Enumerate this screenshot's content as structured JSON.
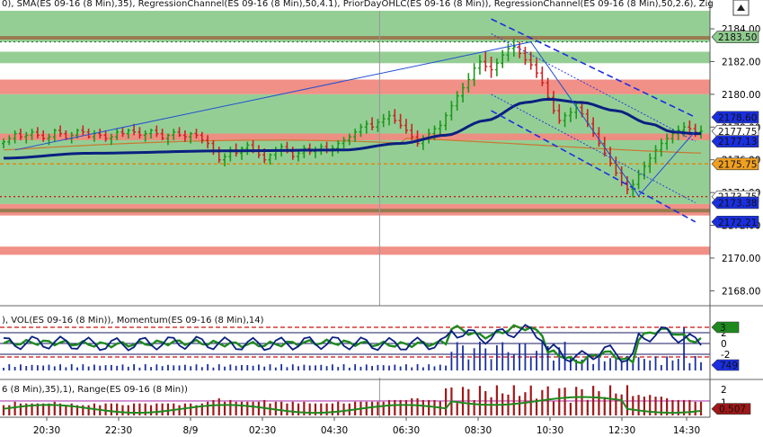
{
  "header": {
    "price_title": "0), SMA(ES 09-16 (8 Min),35), RegressionChannel(ES 09-16 (8 Min),50,4.1), PriorDayOHLC(ES 09-16 (8 Min)), RegressionChannel(ES 09-16 (8 Min),50,2.6), Zig",
    "indicator_title": "), VOL(ES 09-16 (8 Min)), Momentum(ES 09-16 (8 Min),14)",
    "range_title": "6 (8 Min),35),1), Range(ES 09-16 (8 Min))"
  },
  "colors": {
    "green_zone": "#8fcb8f",
    "red_zone": "#f08a80",
    "up_bar": "#1a9a1a",
    "down_bar": "#cc2222",
    "sma": "#0a2080",
    "channel": "#1a2fe0",
    "volume": "#1a2fa0",
    "momentum": "#1e8a1e",
    "range_bar": "#a01818"
  },
  "chart_data": [
    {
      "type": "candlestick",
      "title": "",
      "ylim": [
        2167.2,
        2185.1
      ],
      "y_ticks": [
        "2184.00",
        "2182.00",
        "2180.00",
        "2178.00",
        "2176.00",
        "2174.00",
        "2172.00",
        "2170.00",
        "2168.00"
      ],
      "price_labels": [
        {
          "text": "2183.50",
          "value": 2183.5,
          "bg": "#8fcb8f",
          "fg": "#000000"
        },
        {
          "text": "2178.60",
          "value": 2178.6,
          "bg": "#1a2fe0",
          "fg": "#ffffff"
        },
        {
          "text": "2177.75",
          "value": 2177.75,
          "bg": "#ffffff",
          "fg": "#000000"
        },
        {
          "text": "2177.13",
          "value": 2177.13,
          "bg": "#1a2fe0",
          "fg": "#ffffff"
        },
        {
          "text": "2175.75",
          "value": 2175.75,
          "bg": "#f0a020",
          "fg": "#000000"
        },
        {
          "text": "2173.75",
          "value": 2173.75,
          "bg": "#ffffff",
          "fg": "#cc0000"
        },
        {
          "text": "2173.38",
          "value": 2173.38,
          "bg": "#1a2fe0",
          "fg": "#ffffff"
        },
        {
          "text": "2172.21",
          "value": 2172.21,
          "bg": "#1a2fe0",
          "fg": "#ffffff"
        }
      ],
      "zones": [
        {
          "from": 2183.2,
          "to": 2185.1,
          "kind": "green"
        },
        {
          "from": 2181.9,
          "to": 2182.6,
          "kind": "green"
        },
        {
          "from": 2180.0,
          "to": 2180.9,
          "kind": "red"
        },
        {
          "from": 2173.3,
          "to": 2180.0,
          "kind": "green"
        },
        {
          "from": 2177.2,
          "to": 2177.6,
          "kind": "red"
        },
        {
          "from": 2172.6,
          "to": 2173.3,
          "kind": "red"
        },
        {
          "from": 2170.2,
          "to": 2170.7,
          "kind": "red"
        }
      ],
      "bars": [
        [
          2177.0,
          2177.3,
          2176.7,
          2177.1
        ],
        [
          2177.1,
          2177.5,
          2176.9,
          2177.3
        ],
        [
          2177.3,
          2177.8,
          2177.0,
          2177.6
        ],
        [
          2177.6,
          2177.9,
          2177.2,
          2177.4
        ],
        [
          2177.4,
          2177.7,
          2177.0,
          2177.5
        ],
        [
          2177.5,
          2177.9,
          2177.2,
          2177.7
        ],
        [
          2177.7,
          2178.0,
          2177.3,
          2177.5
        ],
        [
          2177.5,
          2177.8,
          2177.1,
          2177.3
        ],
        [
          2177.3,
          2177.6,
          2176.9,
          2177.4
        ],
        [
          2177.4,
          2177.9,
          2177.1,
          2177.8
        ],
        [
          2177.8,
          2178.1,
          2177.4,
          2177.6
        ],
        [
          2177.6,
          2177.8,
          2177.2,
          2177.3
        ],
        [
          2177.3,
          2177.7,
          2177.0,
          2177.5
        ],
        [
          2177.5,
          2177.9,
          2177.3,
          2177.8
        ],
        [
          2177.8,
          2178.1,
          2177.5,
          2177.7
        ],
        [
          2177.7,
          2177.9,
          2177.3,
          2177.4
        ],
        [
          2177.4,
          2177.8,
          2177.1,
          2177.6
        ],
        [
          2177.6,
          2177.9,
          2177.3,
          2177.5
        ],
        [
          2177.5,
          2177.8,
          2177.1,
          2177.3
        ],
        [
          2177.3,
          2177.6,
          2176.9,
          2177.4
        ],
        [
          2177.4,
          2177.9,
          2177.2,
          2177.7
        ],
        [
          2177.7,
          2178.0,
          2177.4,
          2177.6
        ],
        [
          2177.6,
          2177.9,
          2177.3,
          2177.8
        ],
        [
          2177.8,
          2178.2,
          2177.5,
          2177.7
        ],
        [
          2177.7,
          2178.0,
          2177.3,
          2177.5
        ],
        [
          2177.5,
          2177.8,
          2177.1,
          2177.6
        ],
        [
          2177.6,
          2177.9,
          2177.3,
          2177.8
        ],
        [
          2177.8,
          2178.1,
          2177.4,
          2177.6
        ],
        [
          2177.6,
          2177.9,
          2177.2,
          2177.3
        ],
        [
          2177.3,
          2177.6,
          2176.9,
          2177.5
        ],
        [
          2177.5,
          2177.9,
          2177.2,
          2177.7
        ],
        [
          2177.7,
          2178.0,
          2177.4,
          2177.5
        ],
        [
          2177.5,
          2177.8,
          2177.1,
          2177.4
        ],
        [
          2177.4,
          2177.7,
          2177.0,
          2177.6
        ],
        [
          2177.6,
          2177.9,
          2177.3,
          2177.5
        ],
        [
          2177.5,
          2177.7,
          2177.0,
          2177.2
        ],
        [
          2177.2,
          2177.5,
          2176.7,
          2177.0
        ],
        [
          2177.0,
          2177.2,
          2176.3,
          2176.5
        ],
        [
          2176.5,
          2176.8,
          2175.8,
          2176.0
        ],
        [
          2176.0,
          2176.4,
          2175.6,
          2176.2
        ],
        [
          2176.2,
          2176.8,
          2175.9,
          2176.6
        ],
        [
          2176.6,
          2177.0,
          2176.2,
          2176.4
        ],
        [
          2176.4,
          2176.8,
          2176.0,
          2176.7
        ],
        [
          2176.7,
          2177.1,
          2176.3,
          2176.9
        ],
        [
          2176.9,
          2177.2,
          2176.4,
          2176.6
        ],
        [
          2176.6,
          2176.9,
          2176.1,
          2176.3
        ],
        [
          2176.3,
          2176.7,
          2175.8,
          2176.0
        ],
        [
          2176.0,
          2176.4,
          2175.7,
          2176.3
        ],
        [
          2176.3,
          2176.8,
          2176.0,
          2176.6
        ],
        [
          2176.6,
          2177.0,
          2176.2,
          2176.8
        ],
        [
          2176.8,
          2177.1,
          2176.4,
          2176.5
        ],
        [
          2176.5,
          2176.8,
          2176.0,
          2176.2
        ],
        [
          2176.2,
          2176.6,
          2175.9,
          2176.4
        ],
        [
          2176.4,
          2176.9,
          2176.1,
          2176.7
        ],
        [
          2176.7,
          2177.0,
          2176.3,
          2176.5
        ],
        [
          2176.5,
          2176.8,
          2176.1,
          2176.6
        ],
        [
          2176.6,
          2177.0,
          2176.3,
          2176.8
        ],
        [
          2176.8,
          2177.1,
          2176.4,
          2176.6
        ],
        [
          2176.6,
          2176.9,
          2176.2,
          2176.7
        ],
        [
          2176.7,
          2177.2,
          2176.4,
          2177.0
        ],
        [
          2177.0,
          2177.4,
          2176.7,
          2177.2
        ],
        [
          2177.2,
          2177.6,
          2176.9,
          2177.4
        ],
        [
          2177.4,
          2177.9,
          2177.1,
          2177.7
        ],
        [
          2177.7,
          2178.2,
          2177.4,
          2178.0
        ],
        [
          2178.0,
          2178.4,
          2177.6,
          2178.2
        ],
        [
          2178.2,
          2178.6,
          2177.8,
          2178.0
        ],
        [
          2178.0,
          2178.5,
          2177.7,
          2178.3
        ],
        [
          2178.3,
          2178.8,
          2178.0,
          2178.5
        ],
        [
          2178.5,
          2179.0,
          2178.1,
          2178.7
        ],
        [
          2178.7,
          2179.1,
          2178.2,
          2178.4
        ],
        [
          2178.4,
          2178.8,
          2177.9,
          2178.1
        ],
        [
          2178.1,
          2178.5,
          2177.6,
          2177.8
        ],
        [
          2177.8,
          2178.2,
          2177.2,
          2177.4
        ],
        [
          2177.4,
          2177.8,
          2176.8,
          2177.0
        ],
        [
          2177.0,
          2177.5,
          2176.6,
          2177.3
        ],
        [
          2177.3,
          2177.9,
          2177.0,
          2177.6
        ],
        [
          2177.6,
          2178.1,
          2177.2,
          2177.9
        ],
        [
          2177.9,
          2178.4,
          2177.5,
          2178.1
        ],
        [
          2178.1,
          2178.9,
          2177.8,
          2178.7
        ],
        [
          2178.7,
          2179.6,
          2178.4,
          2179.3
        ],
        [
          2179.3,
          2180.2,
          2179.0,
          2179.9
        ],
        [
          2179.9,
          2180.7,
          2179.5,
          2180.4
        ],
        [
          2180.4,
          2181.3,
          2180.1,
          2180.9
        ],
        [
          2180.9,
          2181.9,
          2180.5,
          2181.6
        ],
        [
          2181.6,
          2182.4,
          2181.2,
          2182.0
        ],
        [
          2182.0,
          2182.6,
          2181.4,
          2181.7
        ],
        [
          2181.7,
          2182.3,
          2181.0,
          2181.5
        ],
        [
          2181.5,
          2182.2,
          2181.1,
          2181.9
        ],
        [
          2181.9,
          2182.7,
          2181.6,
          2182.4
        ],
        [
          2182.4,
          2183.1,
          2182.0,
          2182.8
        ],
        [
          2182.8,
          2183.4,
          2182.3,
          2182.9
        ],
        [
          2182.9,
          2183.2,
          2182.2,
          2182.5
        ],
        [
          2182.5,
          2182.9,
          2181.8,
          2182.1
        ],
        [
          2182.1,
          2182.6,
          2181.5,
          2181.8
        ],
        [
          2181.8,
          2182.2,
          2181.0,
          2181.3
        ],
        [
          2181.3,
          2181.7,
          2180.5,
          2180.7
        ],
        [
          2180.7,
          2181.0,
          2179.6,
          2179.8
        ],
        [
          2179.8,
          2180.2,
          2178.8,
          2179.0
        ],
        [
          2179.0,
          2179.4,
          2178.2,
          2178.4
        ],
        [
          2178.4,
          2178.9,
          2178.0,
          2178.7
        ],
        [
          2178.7,
          2179.2,
          2178.3,
          2178.9
        ],
        [
          2178.9,
          2179.5,
          2178.5,
          2179.2
        ],
        [
          2179.2,
          2179.6,
          2178.6,
          2178.8
        ],
        [
          2178.8,
          2179.1,
          2178.0,
          2178.2
        ],
        [
          2178.2,
          2178.6,
          2177.4,
          2177.6
        ],
        [
          2177.6,
          2178.0,
          2176.8,
          2177.0
        ],
        [
          2177.0,
          2177.4,
          2176.2,
          2176.4
        ],
        [
          2176.4,
          2176.8,
          2175.6,
          2175.8
        ],
        [
          2175.8,
          2176.2,
          2175.0,
          2175.2
        ],
        [
          2175.2,
          2175.6,
          2174.4,
          2174.6
        ],
        [
          2174.6,
          2175.0,
          2173.9,
          2174.2
        ],
        [
          2174.2,
          2174.8,
          2173.7,
          2174.5
        ],
        [
          2174.5,
          2175.4,
          2174.2,
          2175.1
        ],
        [
          2175.1,
          2175.9,
          2174.8,
          2175.6
        ],
        [
          2175.6,
          2176.4,
          2175.2,
          2176.1
        ],
        [
          2176.1,
          2176.9,
          2175.8,
          2176.6
        ],
        [
          2176.6,
          2177.3,
          2176.2,
          2177.0
        ],
        [
          2177.0,
          2177.6,
          2176.6,
          2177.3
        ],
        [
          2177.3,
          2177.9,
          2177.0,
          2177.6
        ],
        [
          2177.6,
          2178.1,
          2177.2,
          2177.8
        ],
        [
          2177.8,
          2178.3,
          2177.4,
          2178.0
        ],
        [
          2178.0,
          2178.4,
          2177.5,
          2177.9
        ],
        [
          2177.9,
          2178.2,
          2177.4,
          2177.7
        ],
        [
          2177.7,
          2178.1,
          2177.3,
          2177.75
        ]
      ],
      "sma_anchors": [
        [
          0,
          2176.1
        ],
        [
          15,
          2176.4
        ],
        [
          40,
          2176.55
        ],
        [
          60,
          2176.6
        ],
        [
          70,
          2177.0
        ],
        [
          78,
          2177.5
        ],
        [
          85,
          2178.4
        ],
        [
          92,
          2179.5
        ],
        [
          96,
          2179.7
        ],
        [
          102,
          2179.5
        ],
        [
          108,
          2179.0
        ],
        [
          114,
          2178.2
        ],
        [
          118,
          2177.7
        ],
        [
          122,
          2177.6
        ]
      ],
      "series": [
        {
          "name": "SMA(ES 09-16 (8 Min),35)",
          "anchors": [
            [
              0,
              2176.1
            ],
            [
              122,
              2177.5
            ]
          ]
        },
        {
          "name": "RegressionChannel(ES 09-16 (8 Min),50,4.1)",
          "upper": [
            [
              86,
              2184.6
            ],
            [
              122,
              2178.6
            ]
          ],
          "lower": [
            [
              86,
              2179.0
            ],
            [
              122,
              2172.21
            ]
          ]
        },
        {
          "name": "RegressionChannel(ES 09-16 (8 Min),50,2.6)",
          "upper": [
            [
              86,
              2183.7
            ],
            [
              122,
              2177.13
            ]
          ],
          "lower": [
            [
              86,
              2180.0
            ],
            [
              122,
              2173.38
            ]
          ]
        }
      ],
      "prior_day_levels": [
        2183.5,
        2175.75,
        2173.75
      ],
      "zigzag": [
        [
          2,
          2176.6
        ],
        [
          93,
          2183.2
        ],
        [
          112,
          2173.8
        ],
        [
          122,
          2177.75
        ]
      ]
    },
    {
      "type": "bar",
      "title": "VOL / Momentum",
      "ylim": [
        -5,
        5
      ],
      "y_ticks": [
        "2",
        "0",
        "-2"
      ],
      "labels": [
        {
          "text": "3",
          "value": 3,
          "bg": "#1e8a1e",
          "fg": "#ffffff"
        },
        {
          "text": "749",
          "value": 749,
          "bg": "#1a2fe0",
          "fg": "#ffffff"
        }
      ],
      "dashed_levels": [
        3,
        -2.5
      ]
    },
    {
      "type": "bar",
      "title": "Range",
      "ylim": [
        0,
        2.6
      ],
      "y_ticks": [
        "2",
        "1"
      ],
      "labels": [
        {
          "text": "0.507",
          "value": 0.507,
          "bg": "#a01818",
          "fg": "#ffffff"
        }
      ]
    }
  ],
  "x_axis": {
    "labels": [
      {
        "text": "20:30",
        "bar": 6
      },
      {
        "text": "22:30",
        "bar": 16
      },
      {
        "text": "8/9",
        "bar": 26
      },
      {
        "text": "02:30",
        "bar": 36
      },
      {
        "text": "04:30",
        "bar": 46
      },
      {
        "text": "06:30",
        "bar": 56
      },
      {
        "text": "08:30",
        "bar": 66
      },
      {
        "text": "10:30",
        "bar": 76
      },
      {
        "text": "12:30",
        "bar": 86
      },
      {
        "text": "14:30",
        "bar": 95
      }
    ]
  }
}
